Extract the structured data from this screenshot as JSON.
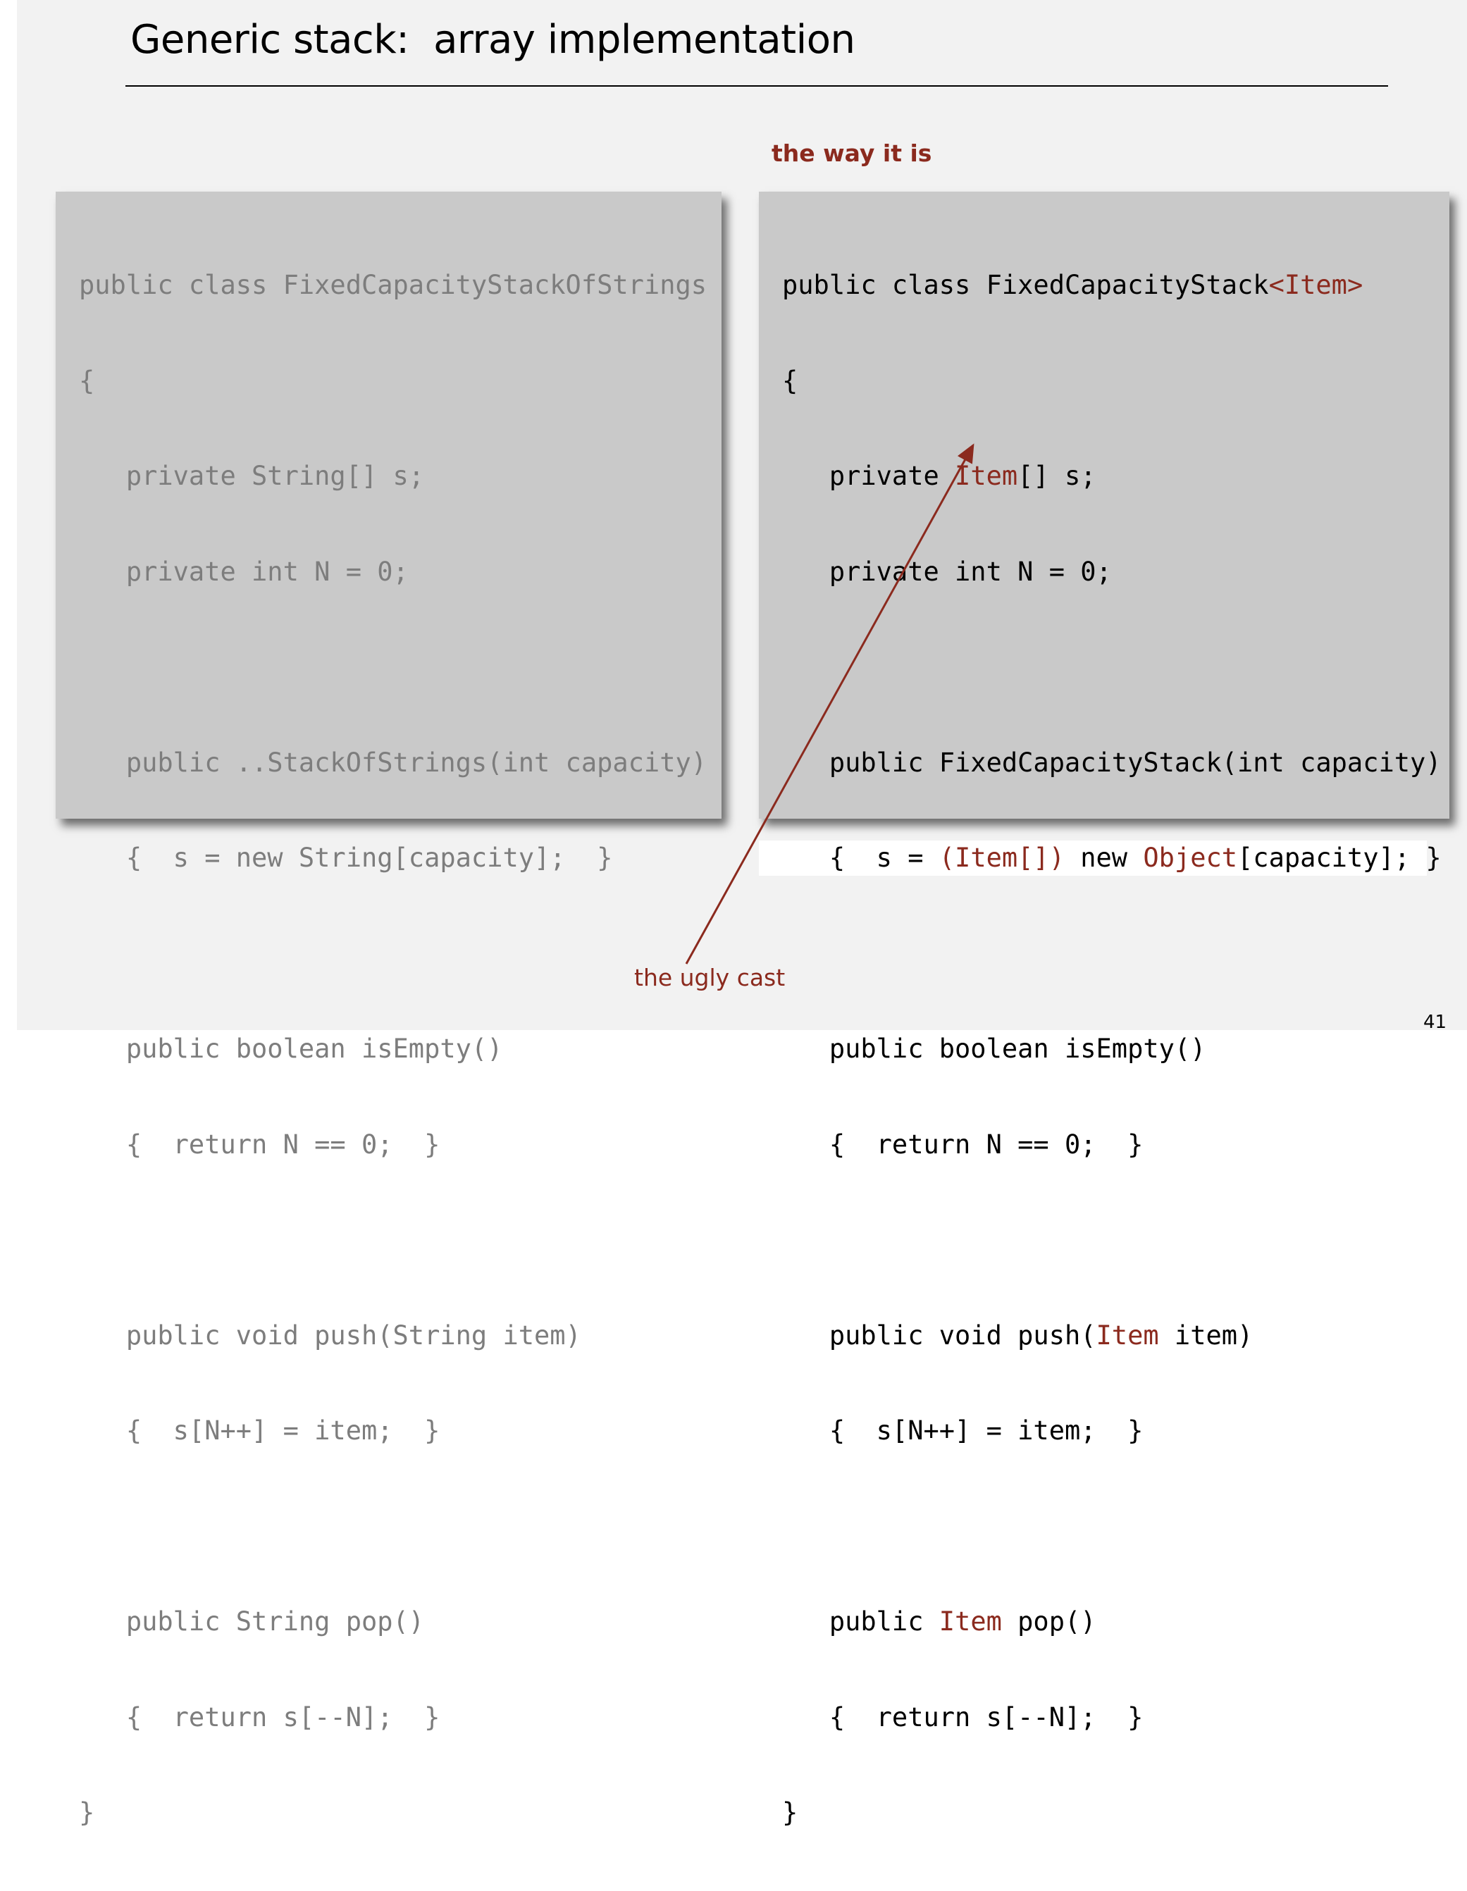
{
  "title": "Generic stack:  array implementation",
  "captions": {
    "the_way_it_is": "the way it is",
    "ugly_cast": "the ugly cast"
  },
  "page_number": "41",
  "colors": {
    "accent": "#8b2a1e",
    "slide_background": "#f2f2f2",
    "code_panel": "#c9c9c9",
    "faded_code": "#7d7d7d"
  },
  "left_code": [
    "public class FixedCapacityStackOfStrings",
    "{",
    "   private String[] s;",
    "   private int N = 0;",
    "",
    "   public ..StackOfStrings(int capacity)",
    "   {  s = new String[capacity];  }",
    "",
    "   public boolean isEmpty()",
    "   {  return N == 0;  }",
    "",
    "   public void push(String item)",
    "   {  s[N++] = item;  }",
    "",
    "   public String pop()",
    "   {  return s[--N];  }",
    "}"
  ],
  "right_code": {
    "l1_a": "public class FixedCapacityStack",
    "l1_b": "<Item>",
    "l2": "{",
    "l3_a": "   private ",
    "l3_b": "Item",
    "l3_c": "[] s;",
    "l4": "   private int N = 0;",
    "l6": "   public FixedCapacityStack(int capacity)",
    "l7_a": "   {  s = ",
    "l7_b": "(Item[])",
    "l7_c": " new ",
    "l7_d": "Object",
    "l7_e": "[capacity]; }",
    "l9": "   public boolean isEmpty()",
    "l10": "   {  return N == 0;  }",
    "l12_a": "   public void push(",
    "l12_b": "Item",
    "l12_c": " item)",
    "l13": "   {  s[N++] = item;  }",
    "l15_a": "   public ",
    "l15_b": "Item",
    "l15_c": " pop()",
    "l16": "   {  return s[--N];  }",
    "l17": "}"
  }
}
